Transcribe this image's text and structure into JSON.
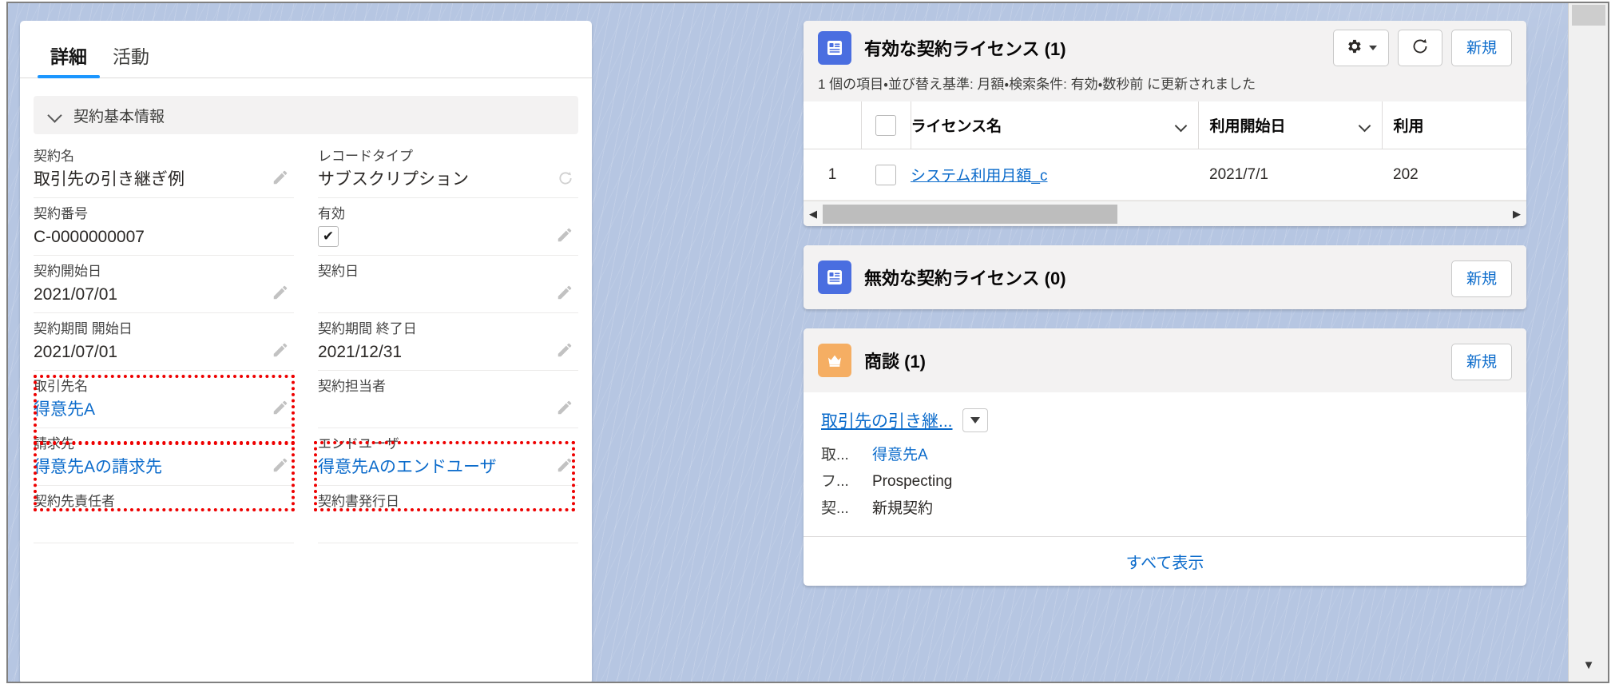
{
  "detail_panel": {
    "tabs": [
      {
        "label": "詳細",
        "active": true
      },
      {
        "label": "活動",
        "active": false
      }
    ],
    "section": {
      "title": "契約基本情報"
    },
    "fields": [
      {
        "label": "契約名",
        "value": "取引先の引き継ぎ例",
        "type": "text",
        "editable": true,
        "col": "left"
      },
      {
        "label": "レコードタイプ",
        "value": "サブスクリプション",
        "type": "text",
        "editable": false,
        "col": "right",
        "icon": "refresh-icon"
      },
      {
        "label": "契約番号",
        "value": "C-0000000007",
        "type": "text",
        "editable": false,
        "col": "left"
      },
      {
        "label": "有効",
        "value": "✔",
        "type": "checkbox",
        "editable": true,
        "col": "right"
      },
      {
        "label": "契約開始日",
        "value": "2021/07/01",
        "type": "text",
        "editable": true,
        "col": "left"
      },
      {
        "label": "契約日",
        "value": "",
        "type": "text",
        "editable": true,
        "col": "right"
      },
      {
        "label": "契約期間 開始日",
        "value": "2021/07/01",
        "type": "text",
        "editable": true,
        "col": "left"
      },
      {
        "label": "契約期間 終了日",
        "value": "2021/12/31",
        "type": "text",
        "editable": true,
        "col": "right"
      },
      {
        "label": "取引先名",
        "value": "得意先A",
        "type": "link",
        "editable": true,
        "col": "left",
        "highlighted": true
      },
      {
        "label": "契約担当者",
        "value": "",
        "type": "text",
        "editable": true,
        "col": "right"
      },
      {
        "label": "請求先",
        "value": "得意先Aの請求先",
        "type": "link",
        "editable": true,
        "col": "left",
        "highlighted": true
      },
      {
        "label": "エンドユーザ",
        "value": "得意先Aのエンドユーザ",
        "type": "link",
        "editable": true,
        "col": "right",
        "highlighted": true
      },
      {
        "label": "契約先責任者",
        "value": "",
        "type": "text",
        "editable": true,
        "col": "left"
      },
      {
        "label": "契約書発行日",
        "value": "",
        "type": "text",
        "editable": true,
        "col": "right"
      }
    ]
  },
  "cards": {
    "active_license": {
      "title": "有効な契約ライセンス (1)",
      "icon": "license-record-icon",
      "subtitle": "1 個の項目・並び替え基準: 月額・検索条件: 有効・数秒前 に更新されました",
      "actions": {
        "settings_label": "",
        "refresh_label": "",
        "new_label": "新規"
      },
      "table": {
        "columns": [
          "ライセンス名",
          "利用開始日",
          "利用"
        ],
        "rows": [
          {
            "num": "1",
            "name": "システム利用月額_c",
            "start": "2021/7/1",
            "end": "202"
          }
        ]
      }
    },
    "inactive_license": {
      "title": "無効な契約ライセンス (0)",
      "icon": "license-record-icon",
      "new_label": "新規"
    },
    "opportunity": {
      "title": "商談 (1)",
      "icon": "crown-icon",
      "new_label": "新規",
      "record": {
        "name": "取引先の引き継...",
        "rows": [
          {
            "key": "取...",
            "value": "得意先A",
            "is_link": true
          },
          {
            "key": "フ...",
            "value": "Prospecting",
            "is_link": false
          },
          {
            "key": "契...",
            "value": "新規契約",
            "is_link": false
          }
        ]
      },
      "view_all_label": "すべて表示"
    }
  },
  "colors": {
    "accent_blue": "#1b96ff",
    "link_blue": "#0b6bcb",
    "annotation_red": "#ee0000",
    "card_icon_blue": "#4a6ee0",
    "card_icon_orange": "#f5ae63",
    "canvas_bg": "#b6c6e2"
  }
}
